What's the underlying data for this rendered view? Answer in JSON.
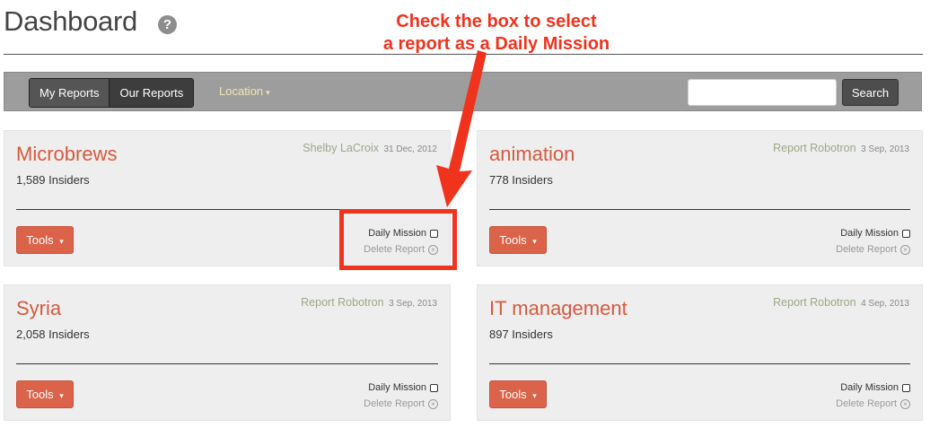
{
  "header": {
    "title": "Dashboard",
    "help_icon": "question-circle-icon",
    "help_glyph": "?"
  },
  "annotation": {
    "line1": "Check the box to select",
    "line2": "a report as a Daily Mission",
    "color": "#f0331c"
  },
  "toolbar": {
    "tabs": [
      {
        "label": "My Reports",
        "active": false
      },
      {
        "label": "Our Reports",
        "active": true
      }
    ],
    "location_label": "Location",
    "location_caret": "▾",
    "search_value": "",
    "search_button": "Search"
  },
  "cards": [
    {
      "title": "Microbrews",
      "author": "Shelby LaCroix",
      "date": "31 Dec, 2012",
      "insiders": "1,589 Insiders",
      "tools_label": "Tools",
      "tools_caret": "▾",
      "daily_mission_label": "Daily Mission",
      "daily_mission_checked": false,
      "delete_label": "Delete Report",
      "delete_glyph": "×"
    },
    {
      "title": "animation",
      "author": "Report Robotron",
      "date": "3 Sep, 2013",
      "insiders": "778 Insiders",
      "tools_label": "Tools",
      "tools_caret": "▾",
      "daily_mission_label": "Daily Mission",
      "daily_mission_checked": false,
      "delete_label": "Delete Report",
      "delete_glyph": "×"
    },
    {
      "title": "Syria",
      "author": "Report Robotron",
      "date": "3 Sep, 2013",
      "insiders": "2,058 Insiders",
      "tools_label": "Tools",
      "tools_caret": "▾",
      "daily_mission_label": "Daily Mission",
      "daily_mission_checked": false,
      "delete_label": "Delete Report",
      "delete_glyph": "×"
    },
    {
      "title": "IT management",
      "author": "Report Robotron",
      "date": "4 Sep, 2013",
      "insiders": "897 Insiders",
      "tools_label": "Tools",
      "tools_caret": "▾",
      "daily_mission_label": "Daily Mission",
      "daily_mission_checked": false,
      "delete_label": "Delete Report",
      "delete_glyph": "×"
    }
  ],
  "colors": {
    "accent": "#d45a3f",
    "button": "#da6349",
    "toolbar": "#9d9d9d",
    "author": "#98a98a"
  }
}
